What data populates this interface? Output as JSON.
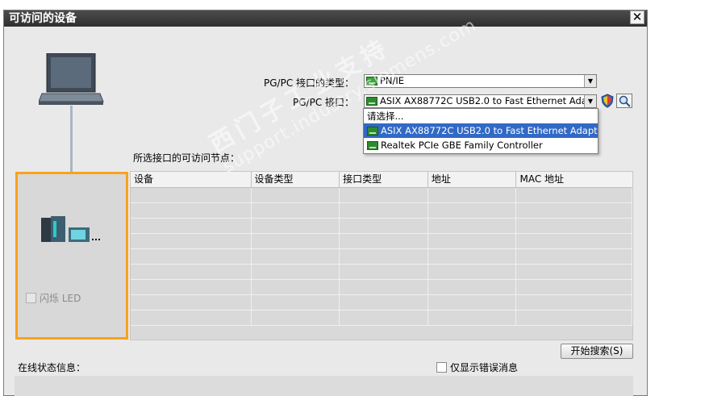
{
  "dialog": {
    "title": "可访问的设备",
    "close_label": "✕"
  },
  "form": {
    "interface_type_label": "PG/PC 接口的类型：",
    "interface_type_value": "PN/IE",
    "interface_label": "PG/PC 接口：",
    "interface_value": "ASIX AX88772C USB2.0 to Fast Ethernet Ada...",
    "dropdown_options": [
      "请选择...",
      "ASIX AX88772C USB2.0 to Fast Ethernet Adapter",
      "Realtek PCIe GBE Family Controller"
    ],
    "dropdown_selected_index": 1
  },
  "nodes": {
    "label": "所选接口的可访问节点：",
    "columns": [
      "设备",
      "设备类型",
      "接口类型",
      "地址",
      "MAC 地址"
    ],
    "rows": []
  },
  "device_panel": {
    "flash_led_label": "闪烁 LED"
  },
  "actions": {
    "start_search_label": "开始搜索(S)",
    "errors_only_label": "仅显示错误消息"
  },
  "status": {
    "label": "在线状态信息："
  },
  "watermark": {
    "line1": "西门子工业支持",
    "line2": "support.industry.siemens.com"
  },
  "colors": {
    "titlebar": "#3a3a3a",
    "highlight_frame": "#f9a21b",
    "selection": "#3169c6"
  }
}
